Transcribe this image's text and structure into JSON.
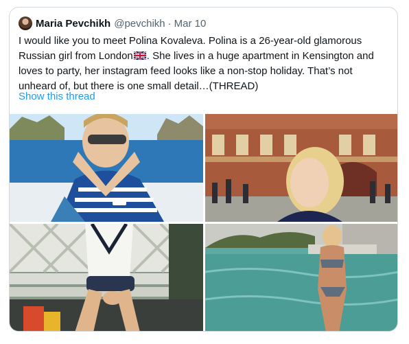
{
  "tweet": {
    "author_name": "Maria Pevchikh",
    "handle": "@pevchikh",
    "separator": "·",
    "date": "Mar 10",
    "text_part1": "I would like you to meet Polina Kovaleva. Polina is a 26-year-old glamorous Russian girl from London",
    "flag_icon": "uk-flag-icon",
    "text_part2": ". She lives in a huge apartment in Kensington and loves to party, her instagram feed looks like a non-stop holiday. That’s not unheard of, but there is one small detail…(THREAD)",
    "show_thread": "Show this thread"
  },
  "media": {
    "photos": [
      {
        "name": "photo-yacht-selfie"
      },
      {
        "name": "photo-royal-albert-hall"
      },
      {
        "name": "photo-bench-sitting"
      },
      {
        "name": "photo-pool-bikini"
      }
    ]
  },
  "colors": {
    "link": "#1d9bf0",
    "secondary_text": "#536471",
    "border": "#cfd9de"
  }
}
